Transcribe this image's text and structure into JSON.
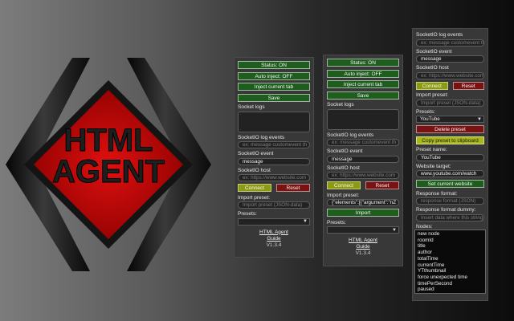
{
  "logo": {
    "line1": "HTML",
    "line2": "AGENT",
    "color_primary": "#c40000",
    "color_text": "#1a1a1a"
  },
  "panels": [
    {
      "status": "Status: ON",
      "auto_inject": "Auto inject: OFF",
      "inject_tab": "Inject current tab",
      "save": "Save",
      "socket_logs_label": "Socket logs",
      "log_events_label": "SocketIO log events",
      "log_events_placeholder": "ex: message customevent th",
      "event_label": "SocketIO event",
      "event_value": "message",
      "host_label": "SocketIO host",
      "host_placeholder": "ex: https://www.website.com",
      "connect": "Connect",
      "reset": "Reset",
      "import_label": "Import preset:",
      "import_placeholder": "Import preset (JSON-data)",
      "presets_label": "Presets:",
      "preset_selected": "",
      "link": "HTML Agent",
      "link2": "Guide",
      "version": "V1.3.4"
    },
    {
      "status": "Status: ON",
      "auto_inject": "Auto inject: OFF",
      "inject_tab": "Inject current tab",
      "save": "Save",
      "socket_logs_label": "Socket logs",
      "log_events_label": "SocketIO log events",
      "log_events_placeholder": "ex: message customevent th",
      "event_label": "SocketIO event",
      "event_value": "message",
      "host_label": "SocketIO host",
      "host_placeholder": "ex: https://www.website.com",
      "connect": "Connect",
      "reset": "Reset",
      "import_label": "Import preset:",
      "import_value": "{\"elements\":[{\"argument\":\"nZ",
      "import_button": "Import",
      "presets_label": "Presets:",
      "preset_selected": "",
      "link": "HTML Agent",
      "link2": "Guide",
      "version": "V1.3.4"
    },
    {
      "log_events_label": "SocketIO log events",
      "log_events_placeholder": "ex: message customevent th",
      "event_label": "SocketIO event",
      "event_value": "message",
      "host_label": "SocketIO host",
      "host_placeholder": "ex: https://www.website.com",
      "connect": "Connect",
      "reset": "Reset",
      "import_label": "Import preset:",
      "import_placeholder": "Import preset (JSON-data)",
      "presets_label": "Presets:",
      "preset_selected": "YouTube",
      "delete_preset": "Delete preset",
      "copy_preset": "Copy preset to clipboard",
      "preset_name_label": "Preset name:",
      "preset_name_value": "YouTube",
      "website_target_label": "Website target:",
      "website_target_value": "www.youtube.com/watch",
      "set_current_website": "Set current website",
      "response_format_label": "Response format:",
      "response_format_placeholder": "response format (JSON)",
      "response_dummy_label": "Response format dummy:",
      "response_dummy_placeholder": "Insert data where this string",
      "nodes_label": "Nodes:",
      "nodes_selected": "",
      "nodes_options": [
        "new node",
        "roomId",
        "title",
        "author",
        "totalTime",
        "currentTime",
        "YTthumbnail",
        "force unexpected time",
        "timePerSecond",
        "paused"
      ]
    }
  ],
  "colors": {
    "green_button": "#1f5d1f",
    "red_button": "#7a1212",
    "olive_button": "#8c9a12",
    "panel_bg": "#383838"
  }
}
